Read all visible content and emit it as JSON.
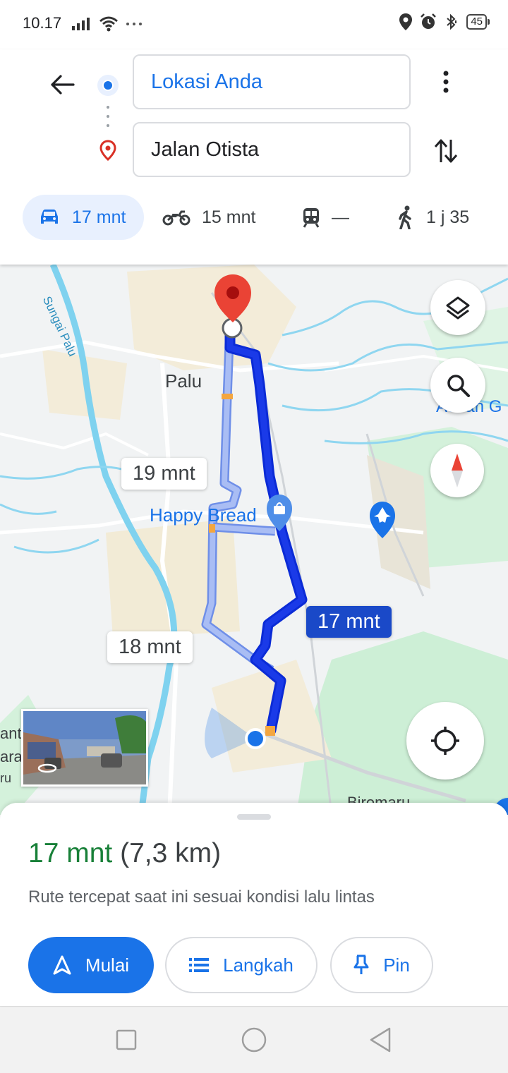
{
  "status": {
    "time": "10.17",
    "battery": "45"
  },
  "header": {
    "origin": "Lokasi Anda",
    "destination": "Jalan Otista",
    "modes": [
      {
        "name": "car",
        "label": "17 mnt",
        "active": true
      },
      {
        "name": "motorbike",
        "label": "15 mnt"
      },
      {
        "name": "transit",
        "label": "—"
      },
      {
        "name": "walk",
        "label": "1 j 35"
      }
    ]
  },
  "map": {
    "labels": {
      "river": "Sungai Palu",
      "city": "Palu",
      "poi": "Happy Bread",
      "edge_right": "Achan G",
      "edge_left_1": "ant",
      "edge_left_2": "ara",
      "edge_left_3": "ru",
      "bottom": "Biromaru"
    },
    "route_bubbles": {
      "alt_1": "19 mnt",
      "alt_2": "18 mnt",
      "main": "17 mnt"
    }
  },
  "sheet": {
    "duration": "17 mnt",
    "distance": "(7,3 km)",
    "note": "Rute tercepat saat ini sesuai kondisi lalu lintas",
    "buttons": {
      "start": "Mulai",
      "steps": "Langkah",
      "pin": "Pin"
    }
  },
  "colors": {
    "accent": "#1a73e8",
    "route_main": "#1a3ae8",
    "route_alt": "#9db3f2",
    "time_green": "#188038"
  }
}
